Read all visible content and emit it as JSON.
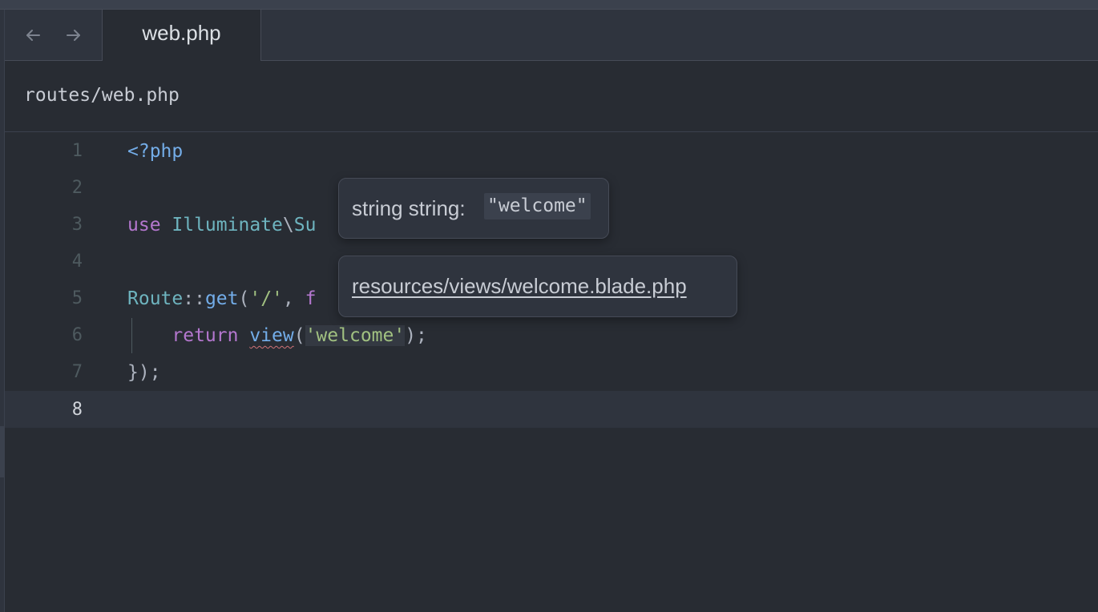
{
  "tab": {
    "label": "web.php"
  },
  "breadcrumb": "routes/web.php",
  "lines": [
    {
      "n": "1",
      "tokens": [
        {
          "t": "<?php",
          "c": "tag"
        }
      ]
    },
    {
      "n": "2",
      "tokens": []
    },
    {
      "n": "3",
      "tokens": [
        {
          "t": "use ",
          "c": "kw"
        },
        {
          "t": "Illuminate",
          "c": "type"
        },
        {
          "t": "\\",
          "c": "punct"
        },
        {
          "t": "Su",
          "c": "type"
        }
      ]
    },
    {
      "n": "4",
      "tokens": []
    },
    {
      "n": "5",
      "tokens": [
        {
          "t": "Route",
          "c": "type"
        },
        {
          "t": "::",
          "c": "punct"
        },
        {
          "t": "get",
          "c": "fn"
        },
        {
          "t": "(",
          "c": "punct"
        },
        {
          "t": "'/'",
          "c": "str"
        },
        {
          "t": ", ",
          "c": "punct"
        },
        {
          "t": "f",
          "c": "kw"
        }
      ]
    },
    {
      "n": "6",
      "tokens": [
        {
          "t": "    return ",
          "c": "kw"
        },
        {
          "t": "view",
          "c": "fn err"
        },
        {
          "t": "(",
          "c": "punct"
        },
        {
          "t": "'welcome'",
          "c": "str hl"
        },
        {
          "t": ");",
          "c": "punct"
        }
      ]
    },
    {
      "n": "7",
      "tokens": [
        {
          "t": "});",
          "c": "punct"
        }
      ]
    },
    {
      "n": "8",
      "tokens": [],
      "active": true
    }
  ],
  "hover": {
    "type_label": "string string: ",
    "type_value": "\"welcome\"",
    "link": "resources/views/welcome.blade.php"
  },
  "colors": {
    "background": "#282c33",
    "keyword": "#b477cf",
    "function": "#73ade9",
    "string": "#a1c181",
    "type": "#6eb4bf",
    "error_underline": "#d07277"
  },
  "icons": {
    "back": "arrow-left-icon",
    "forward": "arrow-right-icon"
  }
}
